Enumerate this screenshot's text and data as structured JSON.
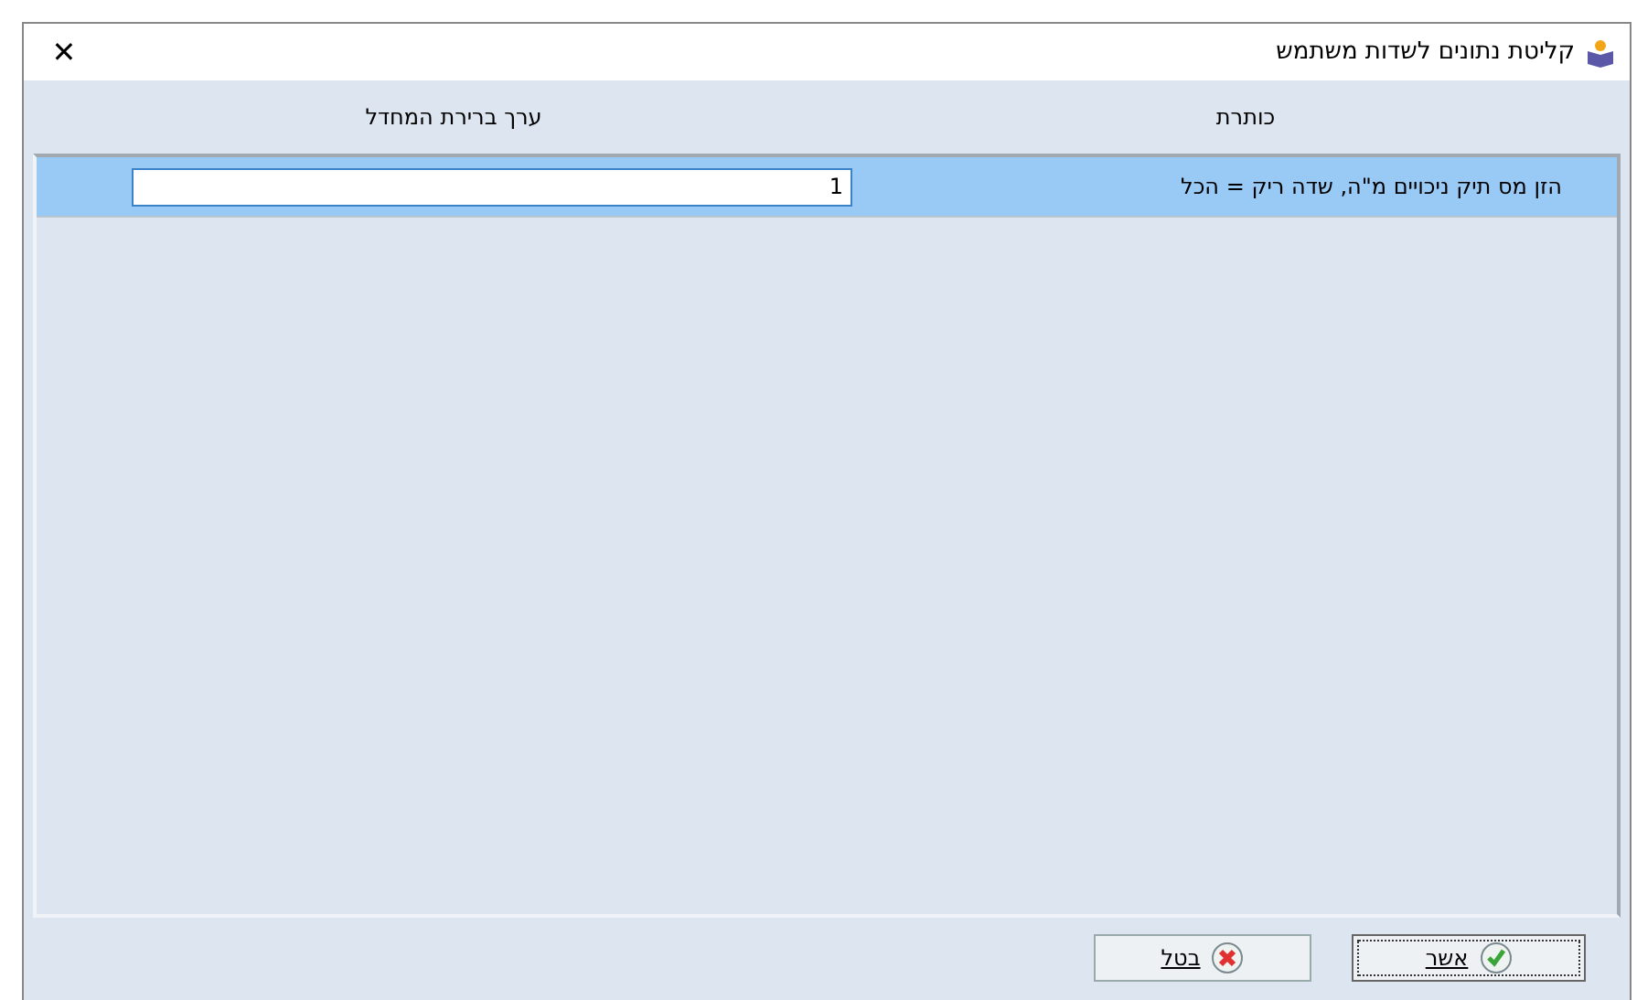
{
  "window": {
    "title": "קליטת נתונים לשדות משתמש",
    "close": "✕"
  },
  "table": {
    "columns": [
      "כותרת",
      "ערך ברירת המחדל"
    ],
    "rows": [
      {
        "title": "הזן מס תיק ניכויים מ\"ה, שדה ריק = הכל",
        "value": "1",
        "selected": true
      }
    ]
  },
  "buttons": [
    {
      "label": "אשר",
      "kind": "ok",
      "focused": true
    },
    {
      "label": "בטל",
      "kind": "cancel",
      "focused": false
    }
  ]
}
